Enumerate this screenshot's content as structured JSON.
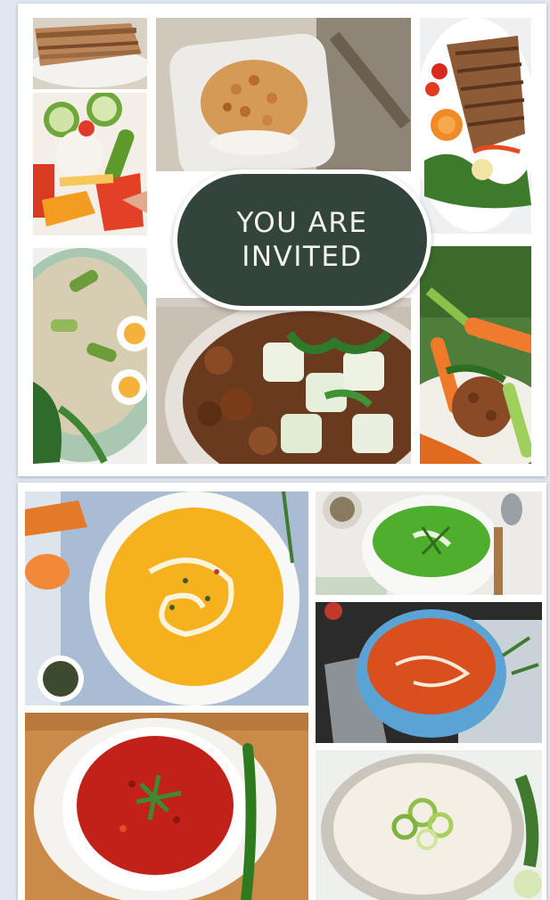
{
  "invitation": {
    "line1": "YOU ARE",
    "line2": "INVITED"
  },
  "colors": {
    "background": "#dfe7f3",
    "card": "#ffffff",
    "badge": "#33443d",
    "badge_text": "#f3f1ec"
  },
  "collage_top": {
    "photos": [
      {
        "name": "pastry-slice-photo"
      },
      {
        "name": "rice-bowl-photo"
      },
      {
        "name": "grilled-fish-plate-photo"
      },
      {
        "name": "egg-vegetable-salad-photo"
      },
      {
        "name": "rice-salad-eggs-photo"
      },
      {
        "name": "mushroom-potato-dish-photo"
      },
      {
        "name": "carrot-meatball-photo"
      }
    ]
  },
  "collage_bottom": {
    "photos": [
      {
        "name": "pumpkin-soup-photo"
      },
      {
        "name": "green-pea-soup-photo"
      },
      {
        "name": "tomato-soup-photo"
      },
      {
        "name": "red-borscht-soup-photo"
      },
      {
        "name": "cream-leek-soup-photo"
      }
    ]
  }
}
